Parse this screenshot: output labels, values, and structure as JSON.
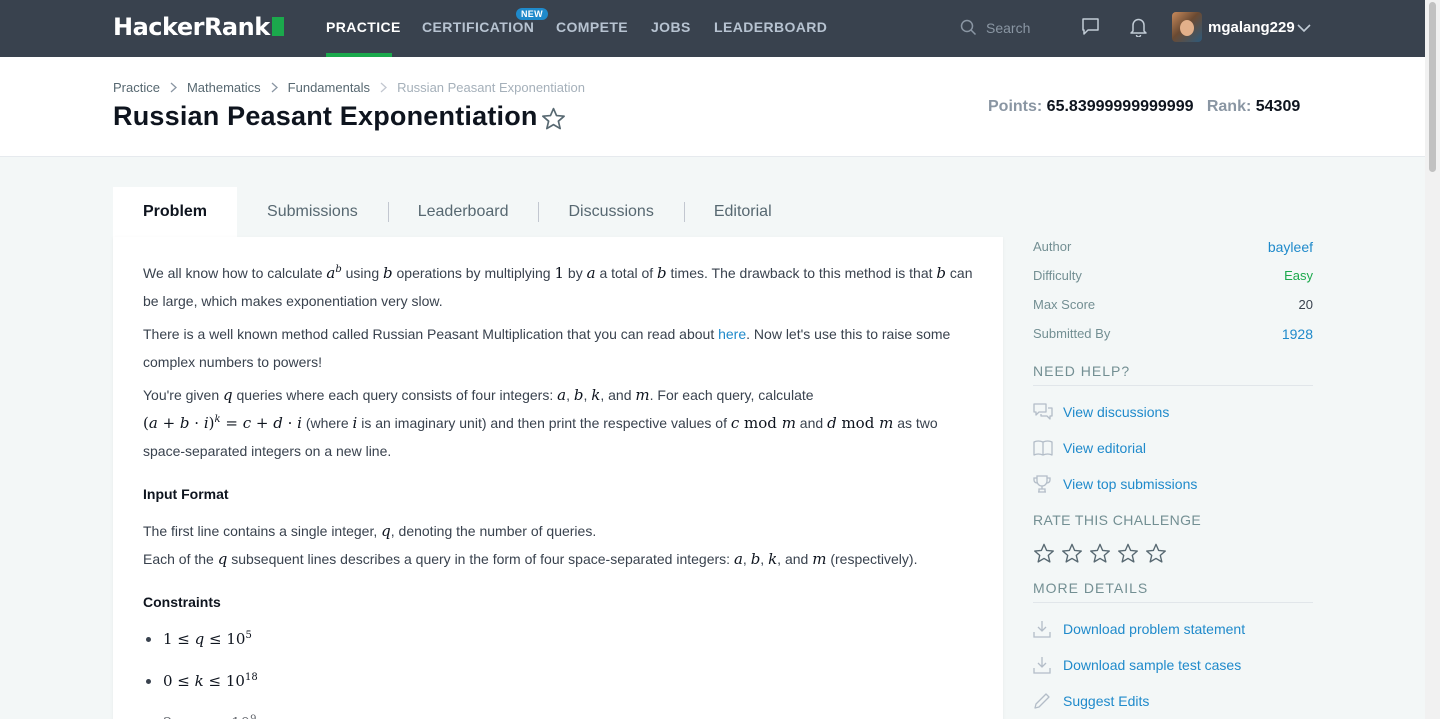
{
  "nav": {
    "logo": "HackerRank",
    "items": [
      "PRACTICE",
      "CERTIFICATION",
      "COMPETE",
      "JOBS",
      "LEADERBOARD"
    ],
    "new_badge": "NEW",
    "search_placeholder": "Search",
    "username": "mgalang229"
  },
  "breadcrumb": [
    "Practice",
    "Mathematics",
    "Fundamentals",
    "Russian Peasant Exponentiation"
  ],
  "title": "Russian Peasant Exponentiation",
  "stats": {
    "points_label": "Points:",
    "points": "65.83999999999999",
    "rank_label": "Rank:",
    "rank": "54309"
  },
  "tabs": [
    "Problem",
    "Submissions",
    "Leaderboard",
    "Discussions",
    "Editorial"
  ],
  "problem": {
    "p1": {
      "t1": "We all know how to calculate ",
      "t2": " using ",
      "t3": " operations by multiplying ",
      "t4": " by ",
      "t5": " a total of ",
      "t6": " times. The drawback to this method is that ",
      "t7": " can be large, which makes exponentiation very slow."
    },
    "p2": {
      "t1": "There is a well known method called Russian Peasant Multiplication that you can read about ",
      "link": "here",
      "t2": ". Now let's use this to raise some complex numbers to powers!"
    },
    "p3": {
      "t1": "You're given ",
      "t2": " queries where each query consists of four integers: ",
      "t3": ", ",
      "t4": ", ",
      "t5": ", and ",
      "t6": ". For each query, calculate ",
      "t7": " (where ",
      "t8": " is an imaginary unit) and then print the respective values of ",
      "t9": " and ",
      "t10": " as two space-separated integers on a new line."
    },
    "input_format_title": "Input Format",
    "input": {
      "l1a": "The first line contains a single integer, ",
      "l1b": ", denoting the number of queries.",
      "l2a": "Each of the ",
      "l2b": " subsequent lines describes a query in the form of four space-separated integers: ",
      "l2c": ", ",
      "l2d": ", ",
      "l2e": ", and ",
      "l2f": " (respectively)."
    },
    "constraints_title": "Constraints"
  },
  "sidebar": {
    "meta": [
      {
        "k": "Author",
        "v": "bayleef"
      },
      {
        "k": "Difficulty",
        "v": "Easy"
      },
      {
        "k": "Max Score",
        "v": "20"
      },
      {
        "k": "Submitted By",
        "v": "1928"
      }
    ],
    "need_help": "NEED HELP?",
    "help_links": [
      "View discussions",
      "View editorial",
      "View top submissions"
    ],
    "rate": "RATE THIS CHALLENGE",
    "more": "MORE DETAILS",
    "more_links": [
      "Download problem statement",
      "Download sample test cases",
      "Suggest Edits"
    ]
  },
  "colors": {
    "nav_bg": "#39424e",
    "accent_green": "#1ba94c",
    "link_blue": "#1f8acb",
    "page_bg": "#f3f7f7"
  },
  "icons": [
    "search-icon",
    "chat-icon",
    "bell-icon",
    "chevron-down-icon",
    "star-icon",
    "discussions-icon",
    "book-icon",
    "trophy-icon",
    "download-icon",
    "pencil-icon"
  ]
}
